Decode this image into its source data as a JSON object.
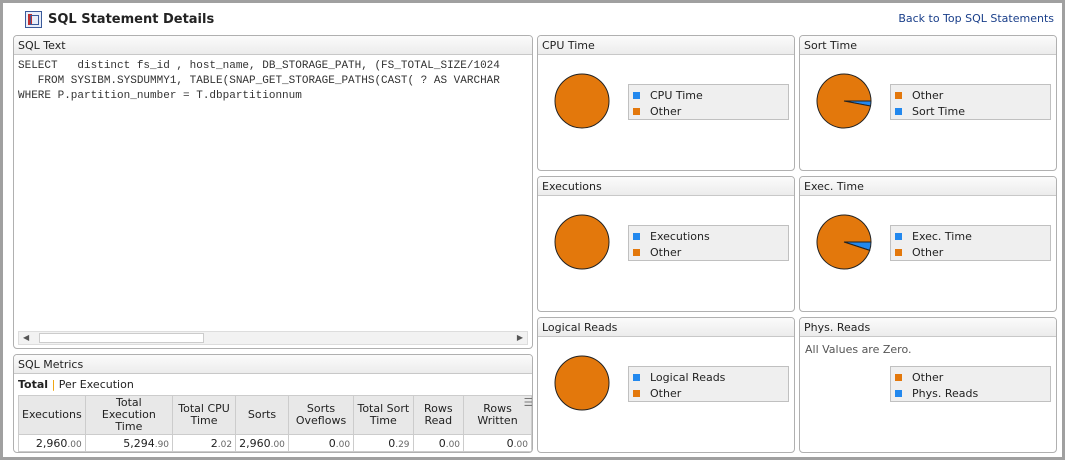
{
  "header": {
    "title": "SQL Statement Details",
    "back_link": "Back to Top SQL Statements"
  },
  "sql_text": {
    "title": "SQL Text",
    "lines": [
      "SELECT   distinct fs_id , host_name, DB_STORAGE_PATH, (FS_TOTAL_SIZE/1024",
      "   FROM SYSIBM.SYSDUMMY1, TABLE(SNAP_GET_STORAGE_PATHS(CAST( ? AS VARCHAR",
      "WHERE P.partition_number = T.dbpartitionnum"
    ]
  },
  "metrics": {
    "title": "SQL Metrics",
    "tab_total": "Total",
    "tab_sep": "|",
    "tab_per_exec": "Per Execution",
    "columns": [
      [
        "Executions",
        ""
      ],
      [
        "Total Execution",
        "Time"
      ],
      [
        "Total CPU",
        "Time"
      ],
      [
        "Sorts",
        ""
      ],
      [
        "Sorts",
        "Oveflows"
      ],
      [
        "Total Sort",
        "Time"
      ],
      [
        "Rows",
        "Read"
      ],
      [
        "Rows",
        "Written"
      ]
    ],
    "row": [
      [
        "2,960",
        ".00"
      ],
      [
        "5,294",
        ".90"
      ],
      [
        "2",
        ".02"
      ],
      [
        "2,960",
        ".00"
      ],
      [
        "0",
        ".00"
      ],
      [
        "0",
        ".29"
      ],
      [
        "0",
        ".00"
      ],
      [
        "0",
        ".00"
      ]
    ]
  },
  "colors": {
    "orange": "#e3780c",
    "blue": "#2288ee"
  },
  "charts": [
    {
      "title": "CPU Time",
      "legend": [
        {
          "label": "CPU Time",
          "color": "#2288ee"
        },
        {
          "label": "Other",
          "color": "#e3780c"
        }
      ],
      "slices": [
        {
          "label": "CPU Time",
          "value": 0.04
        },
        {
          "label": "Other",
          "value": 99.96
        }
      ]
    },
    {
      "title": "Sort Time",
      "legend": [
        {
          "label": "Other",
          "color": "#e3780c"
        },
        {
          "label": "Sort Time",
          "color": "#2288ee"
        }
      ],
      "slices": [
        {
          "label": "Sort Time",
          "value": 3
        },
        {
          "label": "Other",
          "value": 97
        }
      ]
    },
    {
      "title": "Executions",
      "legend": [
        {
          "label": "Executions",
          "color": "#2288ee"
        },
        {
          "label": "Other",
          "color": "#e3780c"
        }
      ],
      "slices": [
        {
          "label": "Executions",
          "value": 0.05
        },
        {
          "label": "Other",
          "value": 99.95
        }
      ]
    },
    {
      "title": "Exec. Time",
      "legend": [
        {
          "label": "Exec. Time",
          "color": "#2288ee"
        },
        {
          "label": "Other",
          "color": "#e3780c"
        }
      ],
      "slices": [
        {
          "label": "Exec. Time",
          "value": 5
        },
        {
          "label": "Other",
          "value": 95
        }
      ]
    },
    {
      "title": "Logical Reads",
      "legend": [
        {
          "label": "Logical Reads",
          "color": "#2288ee"
        },
        {
          "label": "Other",
          "color": "#e3780c"
        }
      ],
      "slices": [
        {
          "label": "Logical Reads",
          "value": 0
        },
        {
          "label": "Other",
          "value": 100
        }
      ]
    },
    {
      "title": "Phys. Reads",
      "message": "All Values are Zero.",
      "legend": [
        {
          "label": "Other",
          "color": "#e3780c"
        },
        {
          "label": "Phys. Reads",
          "color": "#2288ee"
        }
      ],
      "slices": []
    }
  ]
}
